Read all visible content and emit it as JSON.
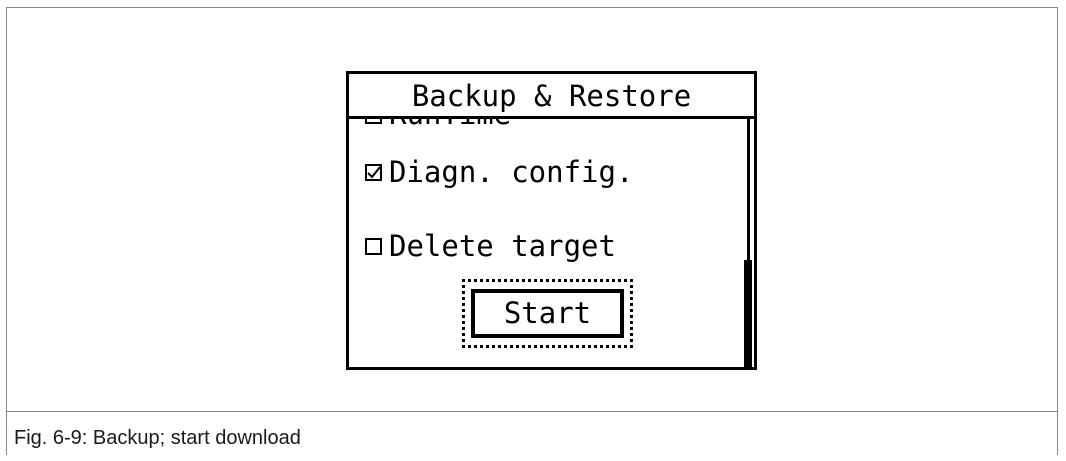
{
  "device": {
    "title": "Backup & Restore",
    "partial_item": "RunTime",
    "items": [
      {
        "label": "Diagn. config.",
        "checked": true
      },
      {
        "label": "Delete target",
        "checked": false
      }
    ],
    "start_label": "Start",
    "scroll_position": 0.56
  },
  "caption": "Fig. 6-9: Backup; start download",
  "icons": {
    "checked": "checkbox-checked-icon",
    "unchecked": "checkbox-unchecked-icon"
  }
}
